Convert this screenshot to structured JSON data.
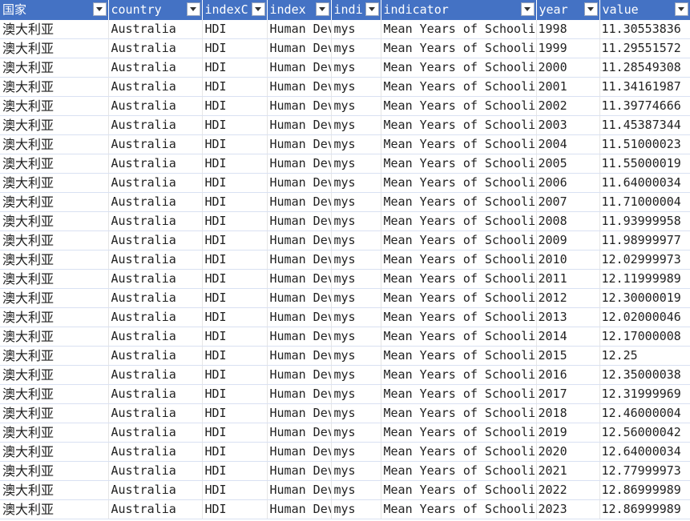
{
  "headers": [
    "国家",
    "country",
    "indexC",
    "index",
    "indi",
    "indicator",
    "year",
    "value"
  ],
  "rows": [
    [
      "澳大利亚",
      "Australia",
      "HDI",
      "Human Dev",
      "mys",
      "Mean Years of Schooli",
      "1998",
      "11.30553836"
    ],
    [
      "澳大利亚",
      "Australia",
      "HDI",
      "Human Dev",
      "mys",
      "Mean Years of Schooli",
      "1999",
      "11.29551572"
    ],
    [
      "澳大利亚",
      "Australia",
      "HDI",
      "Human Dev",
      "mys",
      "Mean Years of Schooli",
      "2000",
      "11.28549308"
    ],
    [
      "澳大利亚",
      "Australia",
      "HDI",
      "Human Dev",
      "mys",
      "Mean Years of Schooli",
      "2001",
      "11.34161987"
    ],
    [
      "澳大利亚",
      "Australia",
      "HDI",
      "Human Dev",
      "mys",
      "Mean Years of Schooli",
      "2002",
      "11.39774666"
    ],
    [
      "澳大利亚",
      "Australia",
      "HDI",
      "Human Dev",
      "mys",
      "Mean Years of Schooli",
      "2003",
      "11.45387344"
    ],
    [
      "澳大利亚",
      "Australia",
      "HDI",
      "Human Dev",
      "mys",
      "Mean Years of Schooli",
      "2004",
      "11.51000023"
    ],
    [
      "澳大利亚",
      "Australia",
      "HDI",
      "Human Dev",
      "mys",
      "Mean Years of Schooli",
      "2005",
      "11.55000019"
    ],
    [
      "澳大利亚",
      "Australia",
      "HDI",
      "Human Dev",
      "mys",
      "Mean Years of Schooli",
      "2006",
      "11.64000034"
    ],
    [
      "澳大利亚",
      "Australia",
      "HDI",
      "Human Dev",
      "mys",
      "Mean Years of Schooli",
      "2007",
      "11.71000004"
    ],
    [
      "澳大利亚",
      "Australia",
      "HDI",
      "Human Dev",
      "mys",
      "Mean Years of Schooli",
      "2008",
      "11.93999958"
    ],
    [
      "澳大利亚",
      "Australia",
      "HDI",
      "Human Dev",
      "mys",
      "Mean Years of Schooli",
      "2009",
      "11.98999977"
    ],
    [
      "澳大利亚",
      "Australia",
      "HDI",
      "Human Dev",
      "mys",
      "Mean Years of Schooli",
      "2010",
      "12.02999973"
    ],
    [
      "澳大利亚",
      "Australia",
      "HDI",
      "Human Dev",
      "mys",
      "Mean Years of Schooli",
      "2011",
      "12.11999989"
    ],
    [
      "澳大利亚",
      "Australia",
      "HDI",
      "Human Dev",
      "mys",
      "Mean Years of Schooli",
      "2012",
      "12.30000019"
    ],
    [
      "澳大利亚",
      "Australia",
      "HDI",
      "Human Dev",
      "mys",
      "Mean Years of Schooli",
      "2013",
      "12.02000046"
    ],
    [
      "澳大利亚",
      "Australia",
      "HDI",
      "Human Dev",
      "mys",
      "Mean Years of Schooli",
      "2014",
      "12.17000008"
    ],
    [
      "澳大利亚",
      "Australia",
      "HDI",
      "Human Dev",
      "mys",
      "Mean Years of Schooli",
      "2015",
      "12.25"
    ],
    [
      "澳大利亚",
      "Australia",
      "HDI",
      "Human Dev",
      "mys",
      "Mean Years of Schooli",
      "2016",
      "12.35000038"
    ],
    [
      "澳大利亚",
      "Australia",
      "HDI",
      "Human Dev",
      "mys",
      "Mean Years of Schooli",
      "2017",
      "12.31999969"
    ],
    [
      "澳大利亚",
      "Australia",
      "HDI",
      "Human Dev",
      "mys",
      "Mean Years of Schooli",
      "2018",
      "12.46000004"
    ],
    [
      "澳大利亚",
      "Australia",
      "HDI",
      "Human Dev",
      "mys",
      "Mean Years of Schooli",
      "2019",
      "12.56000042"
    ],
    [
      "澳大利亚",
      "Australia",
      "HDI",
      "Human Dev",
      "mys",
      "Mean Years of Schooli",
      "2020",
      "12.64000034"
    ],
    [
      "澳大利亚",
      "Australia",
      "HDI",
      "Human Dev",
      "mys",
      "Mean Years of Schooli",
      "2021",
      "12.77999973"
    ],
    [
      "澳大利亚",
      "Australia",
      "HDI",
      "Human Dev",
      "mys",
      "Mean Years of Schooli",
      "2022",
      "12.86999989"
    ],
    [
      "澳大利亚",
      "Australia",
      "HDI",
      "Human Dev",
      "mys",
      "Mean Years of Schooli",
      "2023",
      "12.86999989"
    ]
  ],
  "colors": {
    "header_bg": "#4472c4",
    "header_text": "#ffffff",
    "row_border": "#d9e1f2"
  },
  "icons": {
    "filter": "filter-dropdown-icon"
  }
}
